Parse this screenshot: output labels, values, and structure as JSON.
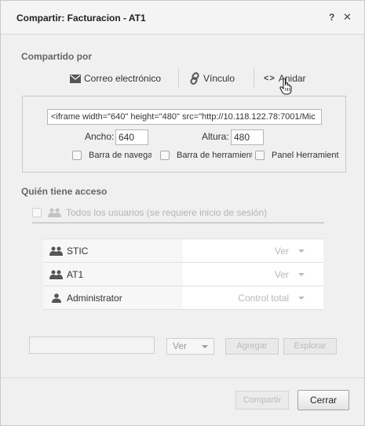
{
  "dialog": {
    "title": "Compartir: Facturacion - AT1",
    "help_label": "?",
    "close_label": "✕"
  },
  "shared_by": {
    "label": "Compartido por",
    "tabs": [
      {
        "label": "Correo electrónico",
        "icon": "envelope-icon"
      },
      {
        "label": "Vínculo",
        "icon": "link-icon"
      },
      {
        "label": "Anidar",
        "icon": "code-icon",
        "selected": true
      }
    ]
  },
  "embed": {
    "code": "<iframe width=\"640\" height=\"480\" src=\"http://10.118.122.78:7001/Mic",
    "width_label": "Ancho:",
    "width_value": "640",
    "height_label": "Altura:",
    "height_value": "480",
    "options": [
      {
        "label": "Barra de navegación",
        "checked": false
      },
      {
        "label": "Barra de herramientas",
        "checked": false
      },
      {
        "label": "Panel Herramient",
        "checked": false
      }
    ]
  },
  "access": {
    "label": "Quién tiene acceso",
    "everyone_label": "Todos los usuarios (se requiere inicio de sesión)",
    "rows": [
      {
        "name": "STIC",
        "type": "group",
        "permission": "Ver"
      },
      {
        "name": "AT1",
        "type": "group",
        "permission": "Ver"
      },
      {
        "name": "Administrator",
        "type": "user",
        "permission": "Control total"
      }
    ]
  },
  "add": {
    "input_value": "",
    "permission": "Ver",
    "add_label": "Agregar",
    "browse_label": "Explorar"
  },
  "footer": {
    "share_label": "Compartir",
    "cancel_label": "Cerrar"
  },
  "colors": {
    "background": "#f0f0f0",
    "disabled_text": "#bbbbbb"
  }
}
